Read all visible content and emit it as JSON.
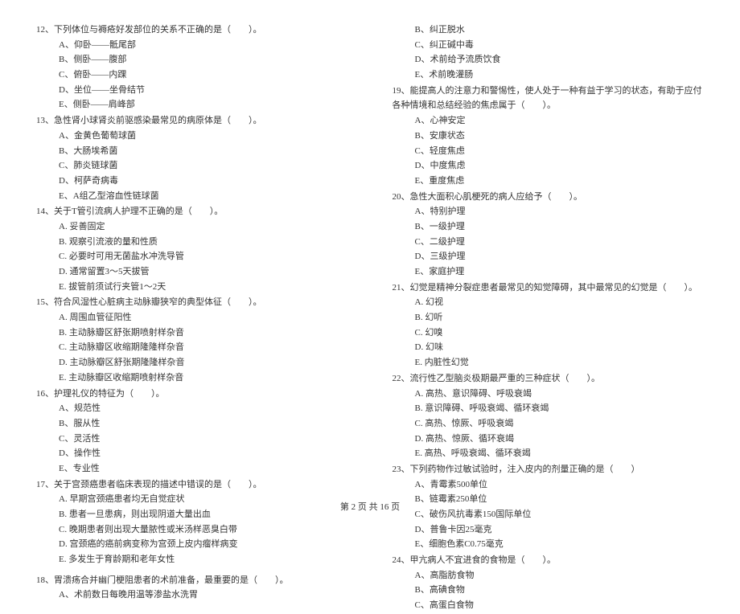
{
  "left": {
    "q12": {
      "text": "12、下列体位与褥疮好发部位的关系不正确的是（　　）。",
      "opts": [
        "A、仰卧——骶尾部",
        "B、侧卧——腹部",
        "C、俯卧——内踝",
        "D、坐位——坐骨结节",
        "E、侧卧——肩峰部"
      ]
    },
    "q13": {
      "text": "13、急性肾小球肾炎前驱感染最常见的病原体是（　　）。",
      "opts": [
        "A、金黄色葡萄球菌",
        "B、大肠埃希菌",
        "C、肺炎链球菌",
        "D、柯萨奇病毒",
        "E、A组乙型溶血性链球菌"
      ]
    },
    "q14": {
      "text": "14、关于T管引流病人护理不正确的是（　　）。",
      "opts": [
        "A. 妥善固定",
        "B. 观察引流液的量和性质",
        "C. 必要时可用无菌盐水冲洗导管",
        "D. 通常留置3～5天拔管",
        "E. 拔管前须试行夹管1～2天"
      ]
    },
    "q15": {
      "text": "15、符合风湿性心脏病主动脉瓣狭窄的典型体征（　　）。",
      "opts": [
        "A. 周围血管征阳性",
        "B. 主动脉瓣区舒张期喷射样杂音",
        "C. 主动脉瓣区收缩期隆隆样杂音",
        "D. 主动脉瓣区舒张期隆隆样杂音",
        "E. 主动脉瓣区收缩期喷射样杂音"
      ]
    },
    "q16": {
      "text": "16、护理礼仪的特征为（　　）。",
      "opts": [
        "A、规范性",
        "B、服从性",
        "C、灵活性",
        "D、操作性",
        "E、专业性"
      ]
    },
    "q17": {
      "text": "17、关于宫颈癌患者临床表现的描述中错误的是（　　）。",
      "opts": [
        "A. 早期宫颈癌患者均无自觉症状",
        "B. 患者一旦患病，则出现阴道大量出血",
        "C. 晚期患者则出现大量脓性或米汤样恶臭白带",
        "D. 宫颈癌的癌前病变称为宫颈上皮内瘤样病变",
        "E. 多发生于育龄期和老年女性"
      ]
    },
    "q18": {
      "text": "18、胃溃疡合并幽门梗阻患者的术前准备，最重要的是（　　）。",
      "opts_partial": [
        "A、术前数日每晚用温等渗盐水洗胃"
      ]
    }
  },
  "right": {
    "q18_cont": {
      "opts": [
        "B、纠正脱水",
        "C、纠正碱中毒",
        "D、术前给予流质饮食",
        "E、术前晚灌肠"
      ]
    },
    "q19": {
      "text": "19、能提高人的注意力和警惕性，使人处于一种有益于学习的状态，有助于应付各种情境和总结经验的焦虑属于（　　）。",
      "opts": [
        "A、心神安定",
        "B、安康状态",
        "C、轻度焦虑",
        "D、中度焦虑",
        "E、重度焦虑"
      ]
    },
    "q20": {
      "text": "20、急性大面积心肌梗死的病人应给予（　　）。",
      "opts": [
        "A、特别护理",
        "B、一级护理",
        "C、二级护理",
        "D、三级护理",
        "E、家庭护理"
      ]
    },
    "q21": {
      "text": "21、幻觉是精神分裂症患者最常见的知觉障碍，其中最常见的幻觉是（　　）。",
      "opts": [
        "A. 幻视",
        "B. 幻听",
        "C. 幻嗅",
        "D. 幻味",
        "E. 内脏性幻觉"
      ]
    },
    "q22": {
      "text": "22、流行性乙型脑炎极期最严重的三种症状（　　）。",
      "opts": [
        "A. 高热、意识障碍、呼吸衰竭",
        "B. 意识障碍、呼吸衰竭、循环衰竭",
        "C. 高热、惊厥、呼吸衰竭",
        "D. 高热、惊厥、循环衰竭",
        "E. 高热、呼吸衰竭、循环衰竭"
      ]
    },
    "q23": {
      "text": "23、下列药物作过敏试验时，注入皮内的剂量正确的是（　　）",
      "opts": [
        "A、青霉素500单位",
        "B、链霉素250单位",
        "C、破伤风抗毒素150国际单位",
        "D、普鲁卡因25毫克",
        "E、细胞色素C0.75毫克"
      ]
    },
    "q24": {
      "text": "24、甲亢病人不宜进食的食物是（　　）。",
      "opts_partial": [
        "A、高脂肪食物",
        "B、高碘食物",
        "C、高蛋白食物"
      ]
    }
  },
  "footer": "第 2 页 共 16 页"
}
